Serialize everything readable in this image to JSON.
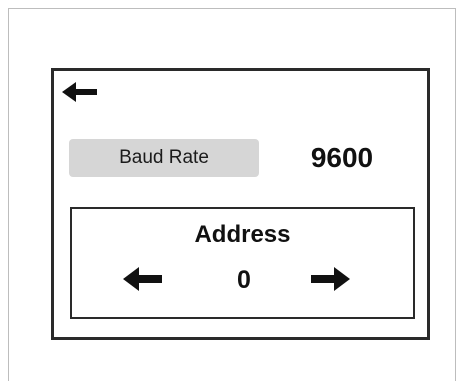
{
  "screen": {
    "back_icon": "arrow-left-icon"
  },
  "settings": {
    "baud_rate_label": "Baud Rate",
    "baud_rate_value": "9600"
  },
  "address": {
    "title": "Address",
    "value": "0",
    "decrement_icon": "arrow-left-icon",
    "increment_icon": "arrow-right-icon"
  },
  "colors": {
    "frame_border": "#2a2a2a",
    "label_background": "#d6d6d6",
    "text": "#111111",
    "outer_border": "#bdbdbd"
  }
}
